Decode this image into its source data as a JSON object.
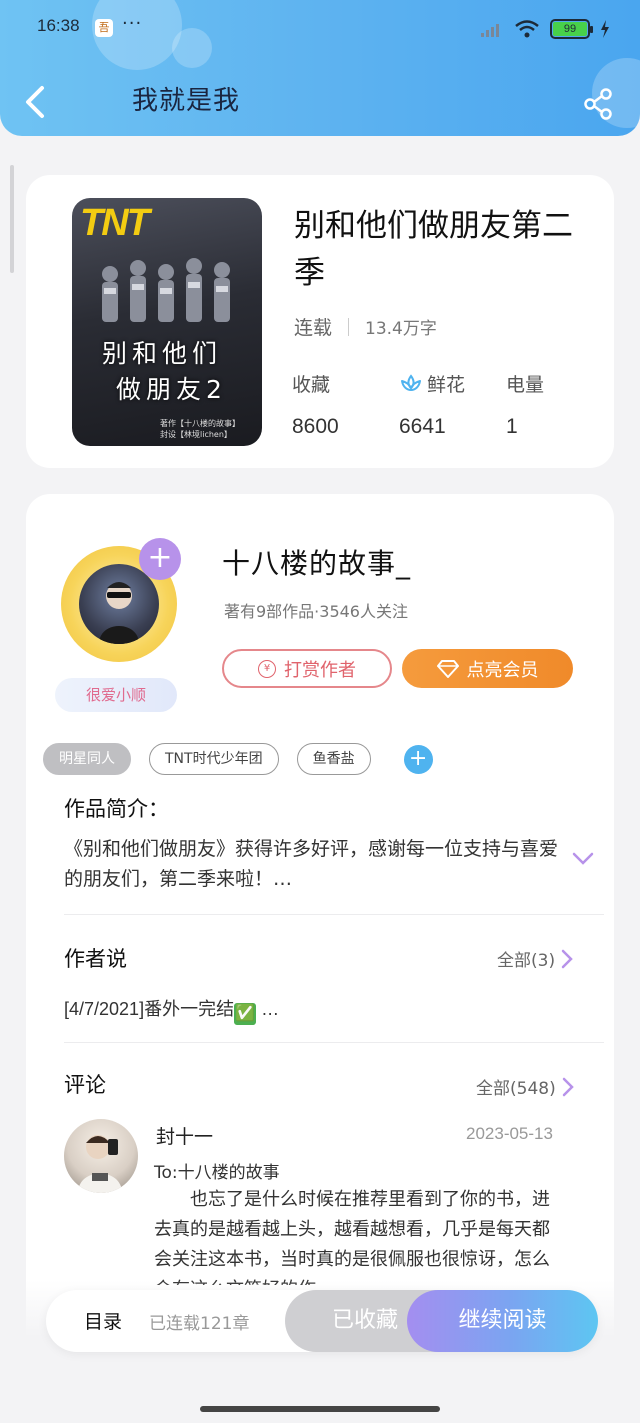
{
  "status_bar": {
    "time": "16:38",
    "notif_icon": "app-notification-icon",
    "more": "···",
    "battery": "99"
  },
  "header": {
    "title": "我就是我",
    "back_icon": "chevron-left-icon",
    "share_icon": "share-icon"
  },
  "book": {
    "cover": {
      "logo": "TNT",
      "title_line1": "别和他们",
      "title_line2": "做朋友2",
      "credit_line1": "著作【十八楼的故事】",
      "credit_line2": "封设【林境lichen】"
    },
    "title": "别和他们做朋友第二季",
    "status": "连载",
    "word_count": "13.4万字",
    "stats": [
      {
        "label": "收藏",
        "value": "8600"
      },
      {
        "label": "鲜花",
        "value": "6641",
        "icon": "flower-icon"
      },
      {
        "label": "电量",
        "value": "1"
      }
    ]
  },
  "author": {
    "name": "十八楼的故事_",
    "meta": "著有9部作品·3546人关注",
    "badge": "很爱小顺",
    "follow_icon": "plus-icon",
    "reward_label": "打赏作者",
    "reward_icon_char": "¥",
    "vip_label": "点亮会员",
    "vip_icon": "diamond-icon"
  },
  "tags": [
    "明星同人",
    "TNT时代少年团",
    "鱼香盐"
  ],
  "tag_add_icon": "plus-icon",
  "synopsis": {
    "heading": "作品简介：",
    "text": "《别和他们做朋友》获得许多好评，感谢每一位支持与喜爱的朋友们，第二季来啦！…",
    "expand_icon": "chevron-down-icon"
  },
  "author_says": {
    "heading": "作者说",
    "more": "全部(3)",
    "post_text": "[4/7/2021]番外一完结",
    "post_emoji": "✅",
    "post_ellipsis": " …"
  },
  "comments": {
    "heading": "评论",
    "more": "全部(548)",
    "items": [
      {
        "user": "封十一",
        "date": "2023-05-13",
        "to": "To:十八楼的故事",
        "body": "也忘了是什么时候在推荐里看到了你的书，进去真的是越看越上头，越看越想看，几乎是每天都会关注这本书，当时真的是很佩服也很惊讶，怎么会有这么文笔好的作"
      }
    ]
  },
  "bottom_bar": {
    "toc": "目录",
    "chapters": "已连载121章",
    "collected": "已收藏",
    "continue": "继续阅读"
  },
  "colors": {
    "header_start": "#6fc3f3",
    "header_end": "#4aa6ef",
    "vip": "#f08a2a",
    "reward": "#e0636c",
    "accent_purple": "#b792ea",
    "continue_gradient_start": "#a48ef0",
    "continue_gradient_end": "#5dc6f2"
  }
}
